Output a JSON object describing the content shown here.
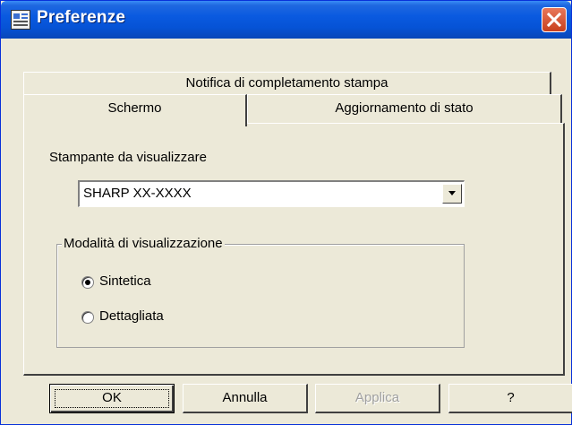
{
  "window": {
    "title": "Preferenze",
    "icons": {
      "app": "preferences-window-icon",
      "close": "close-icon"
    }
  },
  "tabs": {
    "notifica": "Notifica di completamento stampa",
    "schermo": "Schermo",
    "aggiornamento": "Aggiornamento di stato",
    "active": "Schermo"
  },
  "panel": {
    "printer_label": "Stampante da visualizzare",
    "printer_value": "SHARP XX-XXXX",
    "display_mode": {
      "legend": "Modalità di visualizzazione",
      "options": [
        {
          "label": "Sintetica",
          "selected": true
        },
        {
          "label": "Dettagliata",
          "selected": false
        }
      ]
    }
  },
  "buttons": {
    "ok": "OK",
    "cancel": "Annulla",
    "apply": "Applica",
    "help": "?"
  },
  "colors": {
    "titlebar": "#0653D6",
    "close": "#C8401E",
    "face": "#ECE9D8"
  }
}
